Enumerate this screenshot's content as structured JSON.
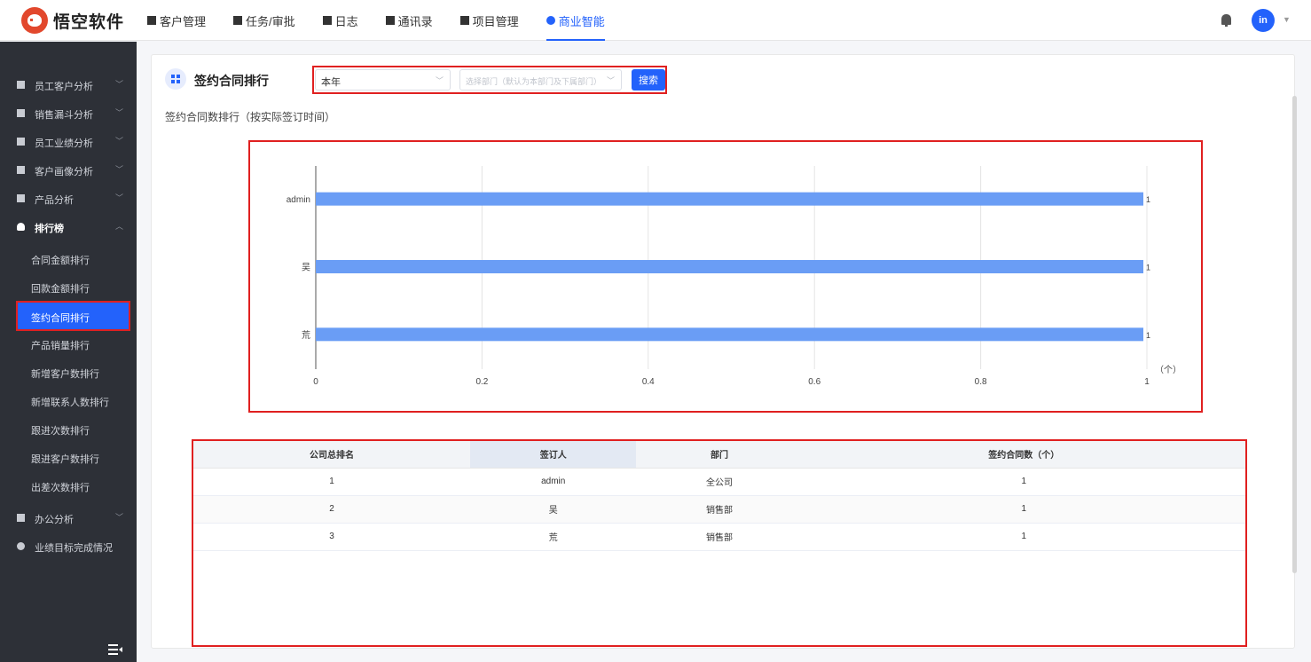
{
  "app": {
    "logo_text": "悟空软件",
    "nav": [
      {
        "label": "客户管理"
      },
      {
        "label": "任务/审批"
      },
      {
        "label": "日志"
      },
      {
        "label": "通讯录"
      },
      {
        "label": "项目管理"
      },
      {
        "label": "商业智能",
        "active": true
      }
    ],
    "user_initials": "in",
    "accent_color": "#2362fb",
    "highlight_color": "#e02020"
  },
  "sidebar": {
    "groups": [
      {
        "label": "员工客户分析",
        "icon": "user-icon"
      },
      {
        "label": "销售漏斗分析",
        "icon": "funnel-icon"
      },
      {
        "label": "员工业绩分析",
        "icon": "bar-chart-icon"
      },
      {
        "label": "客户画像分析",
        "icon": "users-icon"
      },
      {
        "label": "产品分析",
        "icon": "box-icon"
      },
      {
        "label": "排行榜",
        "icon": "trophy-icon",
        "expanded": true
      }
    ],
    "ranking_items": [
      "合同金额排行",
      "回款金额排行",
      "签约合同排行",
      "产品销量排行",
      "新增客户数排行",
      "新增联系人数排行",
      "跟进次数排行",
      "跟进客户数排行",
      "出差次数排行"
    ],
    "active_item": "签约合同排行",
    "tail_groups": [
      {
        "label": "办公分析",
        "icon": "briefcase-icon"
      },
      {
        "label": "业绩目标完成情况",
        "icon": "target-icon"
      }
    ]
  },
  "page": {
    "title": "签约合同排行",
    "period_select": "本年",
    "dept_placeholder": "选择部门（默认为本部门及下属部门）",
    "search_label": "搜索",
    "subtitle": "签约合同数排行（按实际签订时间）"
  },
  "chart_data": {
    "type": "bar",
    "orientation": "horizontal",
    "categories": [
      "admin",
      "吴",
      "荒"
    ],
    "values": [
      1,
      1,
      1
    ],
    "xlim": [
      0,
      1
    ],
    "xticks": [
      "0",
      "0.2",
      "0.4",
      "0.6",
      "0.8",
      "1"
    ],
    "xunit": "（个）",
    "grid": true,
    "bar_color": "#6a9df5"
  },
  "table": {
    "headers": [
      "公司总排名",
      "签订人",
      "部门",
      "签约合同数（个）"
    ],
    "rows": [
      [
        "1",
        "admin",
        "全公司",
        "1"
      ],
      [
        "2",
        "吴",
        "销售部",
        "1"
      ],
      [
        "3",
        "荒",
        "销售部",
        "1"
      ]
    ]
  }
}
